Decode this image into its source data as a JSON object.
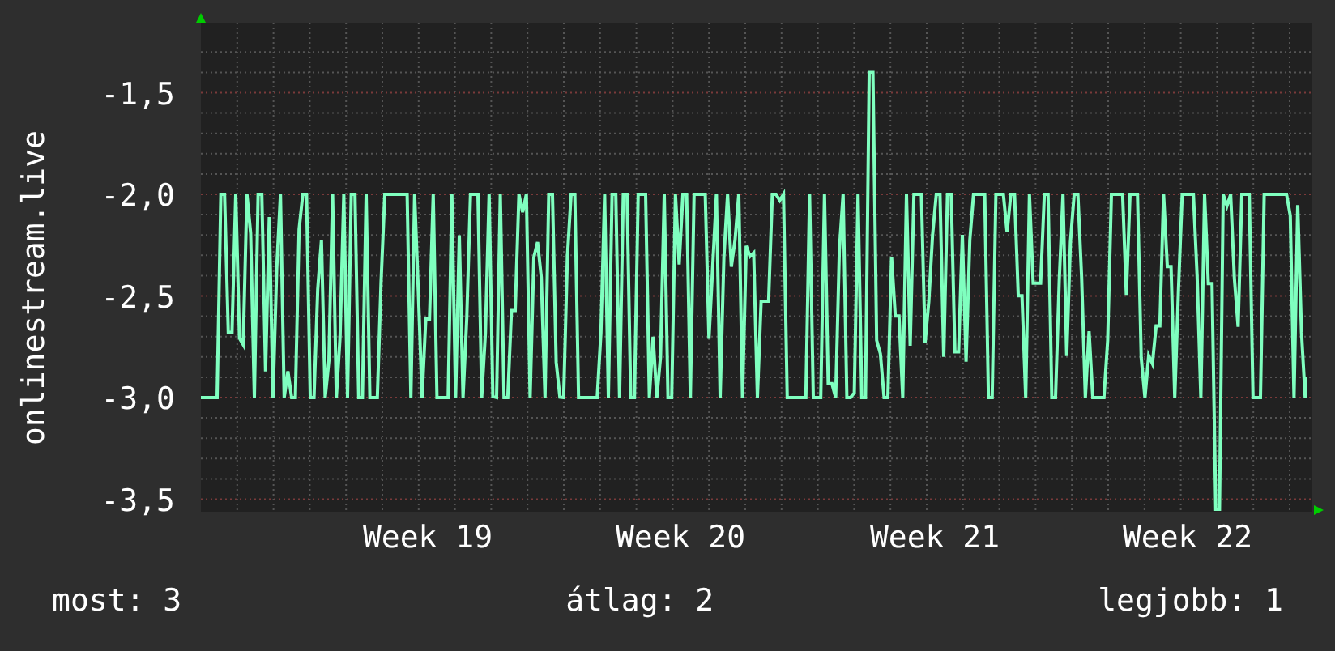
{
  "chart": {
    "y_axis_label": "onlinestream.live",
    "y_tick_labels": [
      "-1,5",
      "-2,0",
      "-2,5",
      "-3,0",
      "-3,5"
    ],
    "x_tick_labels": [
      "Week 19",
      "Week 20",
      "Week 21",
      "Week 22"
    ]
  },
  "stats": [
    "most: 3",
    "átlag: 2",
    "legjobb: 1"
  ]
}
